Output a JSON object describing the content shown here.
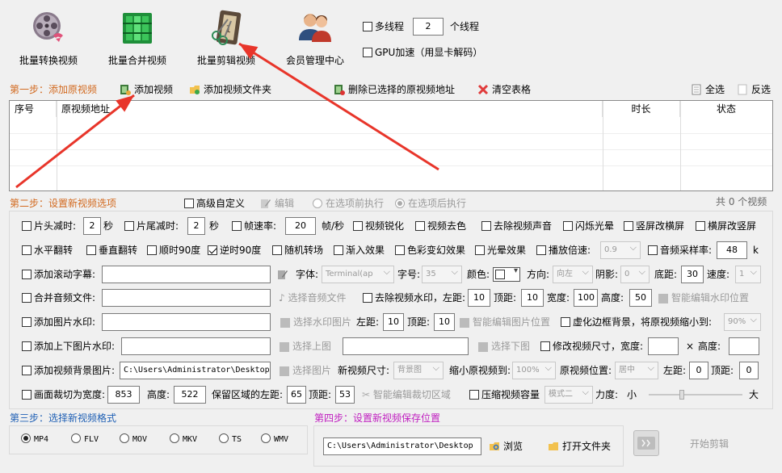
{
  "toolbar": {
    "items": [
      {
        "label": "批量转换视频",
        "icon": "film-reel-icon"
      },
      {
        "label": "批量合并视频",
        "icon": "film-merge-icon"
      },
      {
        "label": "批量剪辑视频",
        "icon": "film-clip-icon"
      },
      {
        "label": "会员管理中心",
        "icon": "members-icon"
      }
    ],
    "multithread_label": "多线程",
    "thread_count": "2",
    "thread_unit": "个线程",
    "gpu_label": "GPU加速（用显卡解码）"
  },
  "step1": {
    "title": "第一步：添加原视频",
    "add_video": "添加视频",
    "add_folder": "添加视频文件夹",
    "delete_selected": "删除已选择的原视频地址",
    "clear_table": "清空表格",
    "select_all": "全选",
    "invert": "反选"
  },
  "table": {
    "columns": [
      "序号",
      "原视频地址",
      "时长",
      "状态"
    ]
  },
  "step2": {
    "title": "第二步：设置新视频选项",
    "advanced": "高级自定义",
    "edit": "编辑",
    "before": "在选项前执行",
    "after": "在选项后执行",
    "count": "共 0 个视频"
  },
  "opts": {
    "r1": {
      "head_cut": "片头减时:",
      "head_val": "2",
      "sec": "秒",
      "tail_cut": "片尾减时:",
      "tail_val": "2",
      "fps": "帧速率:",
      "fps_val": "20",
      "fps_unit": "帧/秒",
      "sharpen": "视频锐化",
      "decolor": "视频去色",
      "remove_audio": "去除视频声音",
      "flash": "闪烁光晕",
      "v2h": "竖屏改横屏",
      "h2v": "横屏改竖屏"
    },
    "r2": {
      "hflip": "水平翻转",
      "vflip": "垂直翻转",
      "cw90": "顺时90度",
      "ccw90": "逆时90度",
      "random_trans": "随机转场",
      "fade_in": "渐入效果",
      "color_fx": "色彩变幻效果",
      "halo": "光晕效果",
      "speed": "播放倍速:",
      "speed_val": "0.9",
      "sample_rate": "音频采样率:",
      "sample_val": "48",
      "sample_unit": "k"
    },
    "r3": {
      "scroll_sub": "添加滚动字幕:",
      "font": "字体:",
      "font_val": "Terminal(ap",
      "size": "字号:",
      "size_val": "35",
      "color": "颜色:",
      "dir": "方向:",
      "dir_val": "向左",
      "shadow": "阴影:",
      "shadow_val": "0",
      "bottom": "底距:",
      "bottom_val": "30",
      "speed": "速度:",
      "speed_val": "1"
    },
    "r4": {
      "merge_audio": "合并音频文件:",
      "choose_audio": "选择音频文件",
      "remove_wm": "去除视频水印，左距:",
      "left_val": "10",
      "top": "顶距:",
      "top_val": "10",
      "width": "宽度:",
      "width_val": "100",
      "height": "高度:",
      "height_val": "50",
      "smart_wm": "智能编辑水印位置"
    },
    "r5": {
      "img_wm": "添加图片水印:",
      "choose_wm": "选择水印图片",
      "left": "左距:",
      "left_val": "10",
      "top": "顶距:",
      "top_val": "10",
      "smart_img": "智能编辑图片位置",
      "blur_bg": "虚化边框背景，将原视频缩小到:",
      "blur_val": "90%"
    },
    "r6": {
      "tb_wm": "添加上下图片水印:",
      "choose_top": "选择上图",
      "choose_bottom": "选择下图",
      "resize": "修改视频尺寸，宽度:",
      "x": "×",
      "height": "高度:"
    },
    "r7": {
      "bg_img": "添加视频背景图片:",
      "bg_path": "C:\\Users\\Administrator\\Desktop\\e",
      "choose_img": "选择图片",
      "new_size": "新视频尺寸:",
      "new_size_val": "背景图",
      "shrink": "缩小原视频到:",
      "shrink_val": "100%",
      "orig_pos": "原视频位置:",
      "pos_val": "居中",
      "left": "左距:",
      "left_val": "0",
      "top": "顶距:",
      "top_val": "0"
    },
    "r8": {
      "crop": "画面裁切为宽度:",
      "crop_w": "853",
      "height": "高度:",
      "crop_h": "522",
      "keep_left": "保留区域的左距:",
      "keep_left_val": "65",
      "top": "顶距:",
      "top_val": "53",
      "smart_crop": "智能编辑裁切区域",
      "compress": "压缩视频容量",
      "mode_val": "模式二",
      "strength": "力度:",
      "small": "小",
      "big": "大",
      "strength_level": 0.35
    }
  },
  "step3": {
    "title": "第三步：选择新视频格式",
    "formats": [
      "MP4",
      "FLV",
      "MOV",
      "MKV",
      "TS",
      "WMV"
    ],
    "selected": "MP4"
  },
  "step4": {
    "title": "第四步：设置新视频保存位置",
    "path": "C:\\Users\\Administrator\\Desktop",
    "browse": "浏览",
    "open_folder": "打开文件夹",
    "start": "开始剪辑"
  },
  "colors": {
    "step_orange": "#d2691e",
    "step_blue": "#1e5fb4",
    "step_magenta": "#c020c0",
    "arrow_red": "#e8352a"
  }
}
